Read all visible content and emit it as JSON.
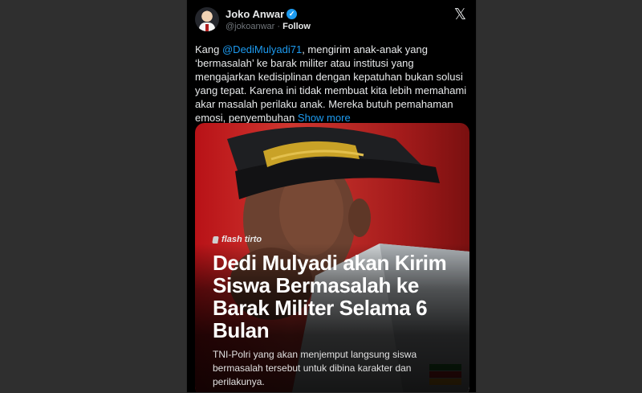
{
  "tweet": {
    "author_name": "Joko Anwar",
    "handle": "@jokoanwar",
    "separator": "·",
    "follow_label": "Follow",
    "text_prefix": "Kang ",
    "mention": "@DediMulyadi71",
    "text_body": ", mengirim anak-anak yang ‘bermasalah’ ke barak militer atau institusi yang mengajarkan kedisiplinan dengan kepatuhan bukan solusi yang tepat. Karena ini tidak membuat kita lebih memahami akar masalah perilaku anak. Mereka butuh pemahaman emosi, penyembuhan ",
    "show_more": "Show more"
  },
  "card": {
    "brand": "flash tirto",
    "headline": "Dedi Mulyadi akan Kirim Siswa Bermasalah ke Barak Militer Selama 6 Bulan",
    "subtext": "TNI-Polri yang akan menjemput langsung siswa bermasalah tersebut untuk dibina karakter dan perilakunya."
  },
  "icons": {
    "verified": "verified-badge-icon",
    "x_logo": "x-logo-icon"
  },
  "colors": {
    "accent": "#1d9bf0",
    "background": "#000000",
    "card_red": "#c8281f"
  }
}
